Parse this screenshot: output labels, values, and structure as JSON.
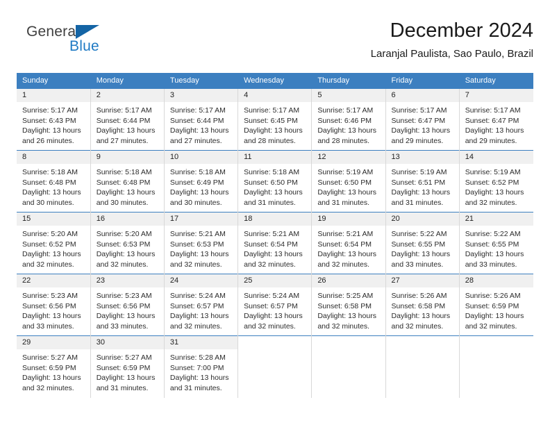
{
  "brand": {
    "name_part1": "General",
    "name_part2": "Blue"
  },
  "header": {
    "title": "December 2024",
    "subtitle": "Laranjal Paulista, Sao Paulo, Brazil"
  },
  "colors": {
    "header_blue": "#3c7fc0",
    "logo_blue": "#1464a5",
    "daynum_bg": "#f0f0f0"
  },
  "weekdays": [
    "Sunday",
    "Monday",
    "Tuesday",
    "Wednesday",
    "Thursday",
    "Friday",
    "Saturday"
  ],
  "weeks": [
    [
      {
        "day": "1",
        "sunrise": "Sunrise: 5:17 AM",
        "sunset": "Sunset: 6:43 PM",
        "daylight1": "Daylight: 13 hours",
        "daylight2": "and 26 minutes."
      },
      {
        "day": "2",
        "sunrise": "Sunrise: 5:17 AM",
        "sunset": "Sunset: 6:44 PM",
        "daylight1": "Daylight: 13 hours",
        "daylight2": "and 27 minutes."
      },
      {
        "day": "3",
        "sunrise": "Sunrise: 5:17 AM",
        "sunset": "Sunset: 6:44 PM",
        "daylight1": "Daylight: 13 hours",
        "daylight2": "and 27 minutes."
      },
      {
        "day": "4",
        "sunrise": "Sunrise: 5:17 AM",
        "sunset": "Sunset: 6:45 PM",
        "daylight1": "Daylight: 13 hours",
        "daylight2": "and 28 minutes."
      },
      {
        "day": "5",
        "sunrise": "Sunrise: 5:17 AM",
        "sunset": "Sunset: 6:46 PM",
        "daylight1": "Daylight: 13 hours",
        "daylight2": "and 28 minutes."
      },
      {
        "day": "6",
        "sunrise": "Sunrise: 5:17 AM",
        "sunset": "Sunset: 6:47 PM",
        "daylight1": "Daylight: 13 hours",
        "daylight2": "and 29 minutes."
      },
      {
        "day": "7",
        "sunrise": "Sunrise: 5:17 AM",
        "sunset": "Sunset: 6:47 PM",
        "daylight1": "Daylight: 13 hours",
        "daylight2": "and 29 minutes."
      }
    ],
    [
      {
        "day": "8",
        "sunrise": "Sunrise: 5:18 AM",
        "sunset": "Sunset: 6:48 PM",
        "daylight1": "Daylight: 13 hours",
        "daylight2": "and 30 minutes."
      },
      {
        "day": "9",
        "sunrise": "Sunrise: 5:18 AM",
        "sunset": "Sunset: 6:48 PM",
        "daylight1": "Daylight: 13 hours",
        "daylight2": "and 30 minutes."
      },
      {
        "day": "10",
        "sunrise": "Sunrise: 5:18 AM",
        "sunset": "Sunset: 6:49 PM",
        "daylight1": "Daylight: 13 hours",
        "daylight2": "and 30 minutes."
      },
      {
        "day": "11",
        "sunrise": "Sunrise: 5:18 AM",
        "sunset": "Sunset: 6:50 PM",
        "daylight1": "Daylight: 13 hours",
        "daylight2": "and 31 minutes."
      },
      {
        "day": "12",
        "sunrise": "Sunrise: 5:19 AM",
        "sunset": "Sunset: 6:50 PM",
        "daylight1": "Daylight: 13 hours",
        "daylight2": "and 31 minutes."
      },
      {
        "day": "13",
        "sunrise": "Sunrise: 5:19 AM",
        "sunset": "Sunset: 6:51 PM",
        "daylight1": "Daylight: 13 hours",
        "daylight2": "and 31 minutes."
      },
      {
        "day": "14",
        "sunrise": "Sunrise: 5:19 AM",
        "sunset": "Sunset: 6:52 PM",
        "daylight1": "Daylight: 13 hours",
        "daylight2": "and 32 minutes."
      }
    ],
    [
      {
        "day": "15",
        "sunrise": "Sunrise: 5:20 AM",
        "sunset": "Sunset: 6:52 PM",
        "daylight1": "Daylight: 13 hours",
        "daylight2": "and 32 minutes."
      },
      {
        "day": "16",
        "sunrise": "Sunrise: 5:20 AM",
        "sunset": "Sunset: 6:53 PM",
        "daylight1": "Daylight: 13 hours",
        "daylight2": "and 32 minutes."
      },
      {
        "day": "17",
        "sunrise": "Sunrise: 5:21 AM",
        "sunset": "Sunset: 6:53 PM",
        "daylight1": "Daylight: 13 hours",
        "daylight2": "and 32 minutes."
      },
      {
        "day": "18",
        "sunrise": "Sunrise: 5:21 AM",
        "sunset": "Sunset: 6:54 PM",
        "daylight1": "Daylight: 13 hours",
        "daylight2": "and 32 minutes."
      },
      {
        "day": "19",
        "sunrise": "Sunrise: 5:21 AM",
        "sunset": "Sunset: 6:54 PM",
        "daylight1": "Daylight: 13 hours",
        "daylight2": "and 32 minutes."
      },
      {
        "day": "20",
        "sunrise": "Sunrise: 5:22 AM",
        "sunset": "Sunset: 6:55 PM",
        "daylight1": "Daylight: 13 hours",
        "daylight2": "and 33 minutes."
      },
      {
        "day": "21",
        "sunrise": "Sunrise: 5:22 AM",
        "sunset": "Sunset: 6:55 PM",
        "daylight1": "Daylight: 13 hours",
        "daylight2": "and 33 minutes."
      }
    ],
    [
      {
        "day": "22",
        "sunrise": "Sunrise: 5:23 AM",
        "sunset": "Sunset: 6:56 PM",
        "daylight1": "Daylight: 13 hours",
        "daylight2": "and 33 minutes."
      },
      {
        "day": "23",
        "sunrise": "Sunrise: 5:23 AM",
        "sunset": "Sunset: 6:56 PM",
        "daylight1": "Daylight: 13 hours",
        "daylight2": "and 33 minutes."
      },
      {
        "day": "24",
        "sunrise": "Sunrise: 5:24 AM",
        "sunset": "Sunset: 6:57 PM",
        "daylight1": "Daylight: 13 hours",
        "daylight2": "and 32 minutes."
      },
      {
        "day": "25",
        "sunrise": "Sunrise: 5:24 AM",
        "sunset": "Sunset: 6:57 PM",
        "daylight1": "Daylight: 13 hours",
        "daylight2": "and 32 minutes."
      },
      {
        "day": "26",
        "sunrise": "Sunrise: 5:25 AM",
        "sunset": "Sunset: 6:58 PM",
        "daylight1": "Daylight: 13 hours",
        "daylight2": "and 32 minutes."
      },
      {
        "day": "27",
        "sunrise": "Sunrise: 5:26 AM",
        "sunset": "Sunset: 6:58 PM",
        "daylight1": "Daylight: 13 hours",
        "daylight2": "and 32 minutes."
      },
      {
        "day": "28",
        "sunrise": "Sunrise: 5:26 AM",
        "sunset": "Sunset: 6:59 PM",
        "daylight1": "Daylight: 13 hours",
        "daylight2": "and 32 minutes."
      }
    ],
    [
      {
        "day": "29",
        "sunrise": "Sunrise: 5:27 AM",
        "sunset": "Sunset: 6:59 PM",
        "daylight1": "Daylight: 13 hours",
        "daylight2": "and 32 minutes."
      },
      {
        "day": "30",
        "sunrise": "Sunrise: 5:27 AM",
        "sunset": "Sunset: 6:59 PM",
        "daylight1": "Daylight: 13 hours",
        "daylight2": "and 31 minutes."
      },
      {
        "day": "31",
        "sunrise": "Sunrise: 5:28 AM",
        "sunset": "Sunset: 7:00 PM",
        "daylight1": "Daylight: 13 hours",
        "daylight2": "and 31 minutes."
      },
      null,
      null,
      null,
      null
    ]
  ]
}
